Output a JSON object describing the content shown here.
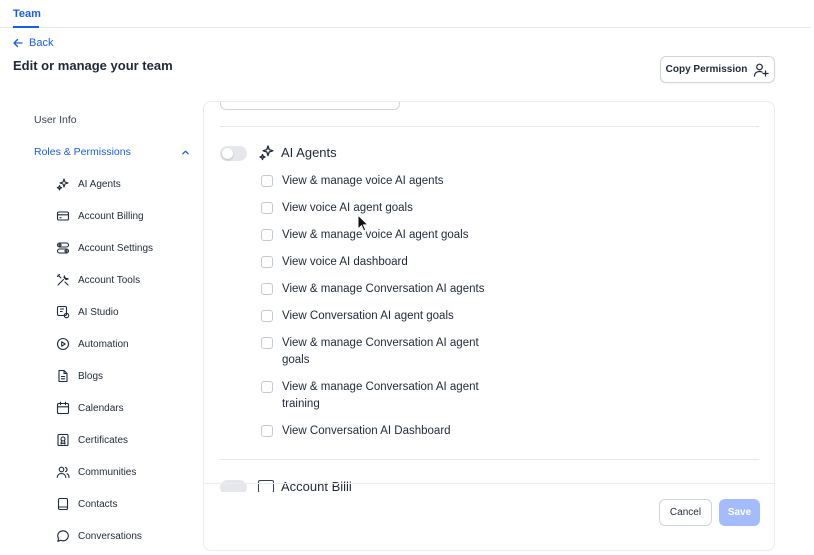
{
  "header": {
    "tab": "Team",
    "back": "Back",
    "title": "Edit or manage your team"
  },
  "actions": {
    "copy_permission": "Copy Permission"
  },
  "sidebar": {
    "user_info": "User Info",
    "roles": "Roles & Permissions",
    "items": [
      {
        "label": "AI Agents",
        "icon": "sparkles-icon"
      },
      {
        "label": "Account Billing",
        "icon": "credit-card-icon"
      },
      {
        "label": "Account Settings",
        "icon": "toggles-icon"
      },
      {
        "label": "Account Tools",
        "icon": "tools-icon"
      },
      {
        "label": "AI Studio",
        "icon": "ai-studio-icon"
      },
      {
        "label": "Automation",
        "icon": "play-circle-icon"
      },
      {
        "label": "Blogs",
        "icon": "document-icon"
      },
      {
        "label": "Calendars",
        "icon": "calendar-icon"
      },
      {
        "label": "Certificates",
        "icon": "certificate-icon"
      },
      {
        "label": "Communities",
        "icon": "users-icon"
      },
      {
        "label": "Contacts",
        "icon": "contacts-book-icon"
      },
      {
        "label": "Conversations",
        "icon": "chat-bubble-icon"
      }
    ]
  },
  "section": {
    "title": "AI Agents",
    "permissions": [
      "View & manage voice AI agents",
      "View voice AI agent goals",
      "View & manage voice AI agent goals",
      "View voice AI dashboard",
      "View & manage Conversation AI agents",
      "View Conversation AI agent goals",
      "View & manage Conversation AI agent goals",
      "View & manage Conversation AI agent training",
      "View Conversation AI Dashboard"
    ],
    "next_title": "Account Billi"
  },
  "footer": {
    "cancel": "Cancel",
    "save": "Save"
  },
  "colors": {
    "accent": "#155eef",
    "save_disabled": "#a4bcfd"
  }
}
